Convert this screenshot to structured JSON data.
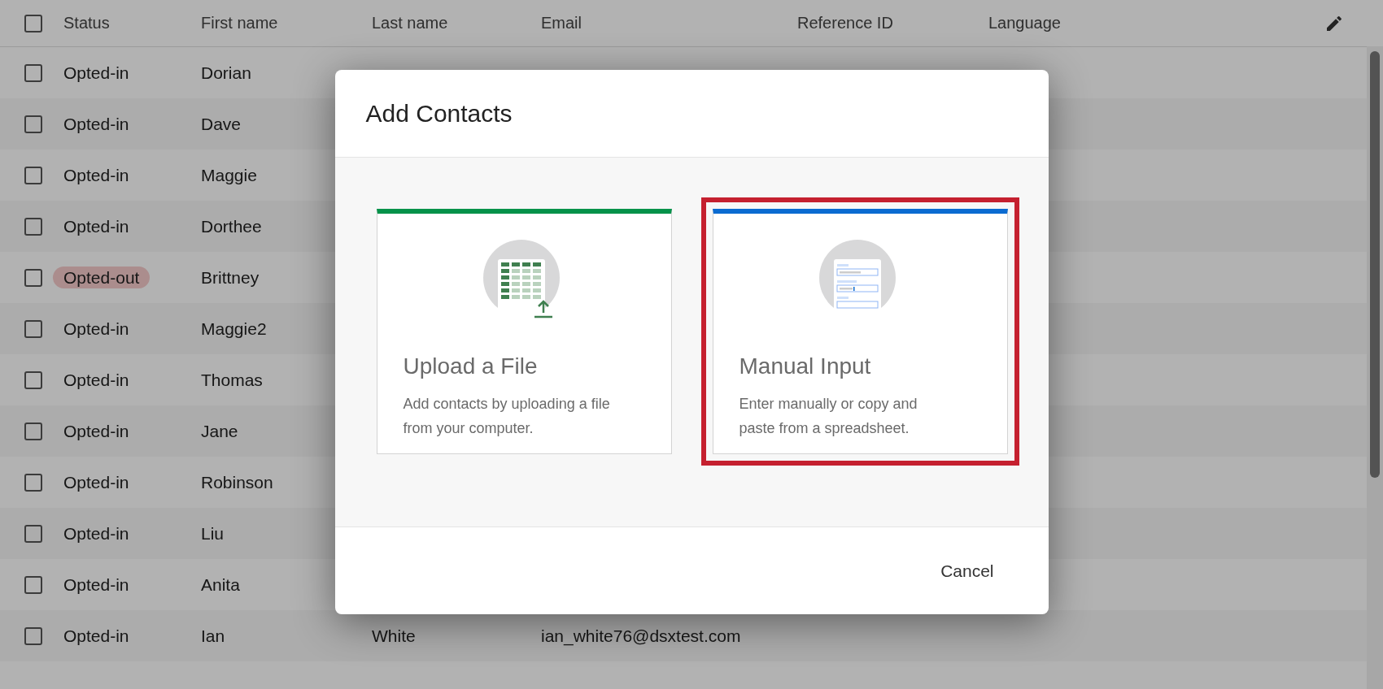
{
  "table": {
    "select_all": {
      "checked": false
    },
    "columns": [
      "Status",
      "First name",
      "Last name",
      "Email",
      "Reference ID",
      "Language"
    ],
    "rows": [
      {
        "checked": false,
        "status": "Opted-in",
        "opted_out": false,
        "first_name": "Dorian"
      },
      {
        "checked": false,
        "status": "Opted-in",
        "opted_out": false,
        "first_name": "Dave"
      },
      {
        "checked": false,
        "status": "Opted-in",
        "opted_out": false,
        "first_name": "Maggie"
      },
      {
        "checked": false,
        "status": "Opted-in",
        "opted_out": false,
        "first_name": "Dorthee"
      },
      {
        "checked": false,
        "status": "Opted-out",
        "opted_out": true,
        "first_name": "Brittney"
      },
      {
        "checked": false,
        "status": "Opted-in",
        "opted_out": false,
        "first_name": "Maggie2"
      },
      {
        "checked": false,
        "status": "Opted-in",
        "opted_out": false,
        "first_name": "Thomas"
      },
      {
        "checked": false,
        "status": "Opted-in",
        "opted_out": false,
        "first_name": "Jane"
      },
      {
        "checked": false,
        "status": "Opted-in",
        "opted_out": false,
        "first_name": "Robinson"
      },
      {
        "checked": false,
        "status": "Opted-in",
        "opted_out": false,
        "first_name": "Liu"
      },
      {
        "checked": false,
        "status": "Opted-in",
        "opted_out": false,
        "first_name": "Anita"
      },
      {
        "checked": false,
        "status": "Opted-in",
        "opted_out": false,
        "first_name": "Ian",
        "last_name": "White",
        "email": "ian_white76@dsxtest.com"
      }
    ]
  },
  "dialog": {
    "title": "Add Contacts",
    "options": [
      {
        "kind": "upload",
        "title": "Upload a File",
        "description": "Add contacts by uploading a file from your computer.",
        "color": "#05924a",
        "selected": false
      },
      {
        "kind": "manual",
        "title": "Manual Input",
        "description": "Enter manually or copy and paste from a spreadsheet.",
        "color": "#0b6bd1",
        "selected": true
      }
    ],
    "buttons": [
      "Cancel"
    ]
  }
}
